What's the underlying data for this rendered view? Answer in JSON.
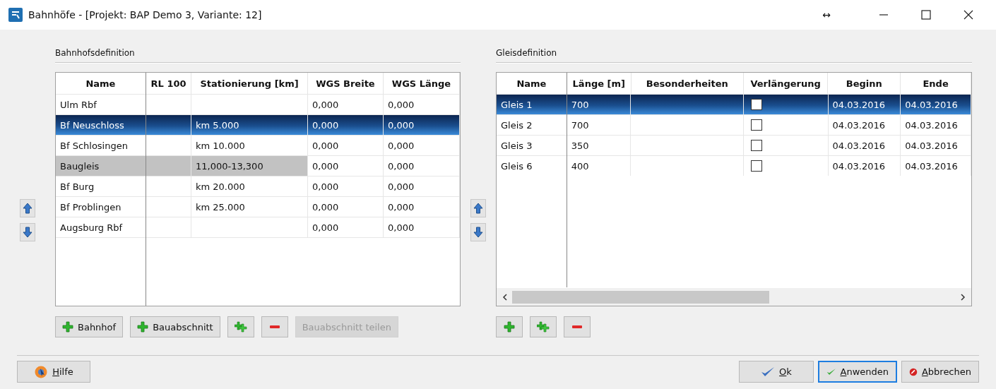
{
  "window": {
    "title": "Bahnhöfe - [Projekt: BAP Demo 3, Variante: 12]",
    "resize_glyph": "↔"
  },
  "stations": {
    "title": "Bahnhofsdefinition",
    "columns": [
      "Name",
      "RL 100",
      "Stationierung [km]",
      "WGS Breite",
      "WGS Länge"
    ],
    "rows": [
      {
        "kind": "station",
        "selected": false,
        "cells": [
          "Ulm Rbf",
          "",
          "",
          "0,000",
          "0,000"
        ]
      },
      {
        "kind": "station",
        "selected": true,
        "cells": [
          "Bf Neuschloss",
          "",
          "km 5.000",
          "0,000",
          "0,000"
        ]
      },
      {
        "kind": "station",
        "selected": false,
        "cells": [
          "Bf Schlosingen",
          "",
          "km 10.000",
          "0,000",
          "0,000"
        ]
      },
      {
        "kind": "section",
        "selected": false,
        "cells": [
          "Baugleis",
          "",
          "11,000-13,300",
          "0,000",
          "0,000"
        ]
      },
      {
        "kind": "station",
        "selected": false,
        "cells": [
          "Bf Burg",
          "",
          "km 20.000",
          "0,000",
          "0,000"
        ]
      },
      {
        "kind": "station",
        "selected": false,
        "cells": [
          "Bf Problingen",
          "",
          "km 25.000",
          "0,000",
          "0,000"
        ]
      },
      {
        "kind": "station",
        "selected": false,
        "cells": [
          "Augsburg Rbf",
          "",
          "",
          "0,000",
          "0,000"
        ]
      }
    ],
    "buttons": [
      {
        "kind": "add",
        "label": "Bahnhof",
        "disabled": false
      },
      {
        "kind": "add",
        "label": "Bauabschnitt",
        "disabled": false
      },
      {
        "kind": "add-multi",
        "disabled": false
      },
      {
        "kind": "remove",
        "disabled": false
      },
      {
        "kind": "text",
        "label": "Bauabschnitt teilen",
        "disabled": true
      }
    ]
  },
  "tracks": {
    "title": "Gleisdefinition",
    "columns": [
      "Name",
      "Länge [m]",
      "Besonderheiten",
      "Verlängerung",
      "Beginn",
      "Ende"
    ],
    "rows": [
      {
        "selected": true,
        "name": "Gleis 1",
        "length": "700",
        "extension": false,
        "begin": "04.03.2016",
        "end": "04.03.2016"
      },
      {
        "selected": false,
        "name": "Gleis 2",
        "length": "700",
        "extension": false,
        "begin": "04.03.2016",
        "end": "04.03.2016"
      },
      {
        "selected": false,
        "name": "Gleis 3",
        "length": "350",
        "extension": false,
        "begin": "04.03.2016",
        "end": "04.03.2016"
      },
      {
        "selected": false,
        "name": "Gleis 6",
        "length": "400",
        "extension": false,
        "begin": "04.03.2016",
        "end": "04.03.2016"
      }
    ],
    "buttons": [
      {
        "kind": "add",
        "disabled": false
      },
      {
        "kind": "add-multi",
        "disabled": false
      },
      {
        "kind": "remove",
        "disabled": false
      }
    ]
  },
  "footer": {
    "help": "Hilfe",
    "buttons": [
      {
        "kind": "ok",
        "label": "Ok",
        "focused": false
      },
      {
        "kind": "apply",
        "label": "Anwenden",
        "focused": true
      },
      {
        "kind": "cancel",
        "label": "Abbrechen",
        "focused": false
      }
    ]
  }
}
